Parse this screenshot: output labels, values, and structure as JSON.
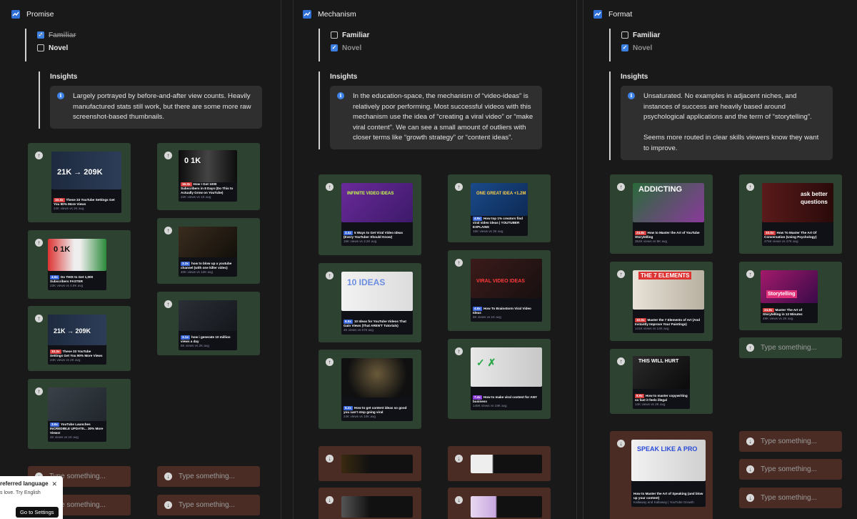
{
  "columns": [
    {
      "title": "Promise",
      "options": [
        {
          "label": "Familiar",
          "checked": true
        },
        {
          "label": "Novel",
          "checked": false
        }
      ],
      "insights_title": "Insights",
      "insights": [
        "Largely portrayed by before-and-after view counts. Heavily manufactured stats still work, but there are some more raw screenshot-based thumbnails."
      ],
      "placeholder": "Type something..."
    },
    {
      "title": "Mechanism",
      "options": [
        {
          "label": "Familiar",
          "checked": false
        },
        {
          "label": "Novel",
          "checked": true
        }
      ],
      "insights_title": "Insights",
      "insights": [
        "In the education-space, the mechanism of “video-ideas” is relatively poor performing. Most successful videos with this mechanism use the idea of “creating a viral video” or “make viral content”. We can see a small amount of outliers with closer terms like  “growth strategy” or “content ideas”."
      ],
      "placeholder": "Type something..."
    },
    {
      "title": "Format",
      "options": [
        {
          "label": "Familiar",
          "checked": false
        },
        {
          "label": "Novel",
          "checked": true
        }
      ],
      "insights_title": "Insights",
      "insights": [
        "Unsaturated. No examples in adjacent niches, and instances of success are heavily based around psychological applications and the term of “storytelling”.",
        "Seems more routed in clear skills viewers know they want to improve."
      ],
      "placeholder": "Type something..."
    }
  ],
  "thumbs": {
    "p1": {
      "big": "21K → 209K",
      "tag": "10.3x",
      "title": "These 33 YouTube Settings Get You 90% More Views",
      "meta": "24K views vs 2K avg"
    },
    "p2": {
      "big": "0  1K",
      "tag": "4.6x",
      "title": "Do THIS to Get 1,000 Subscribers FASTER",
      "meta": "23K views vs 4.9K avg"
    },
    "p3": {
      "big": "21K → 209K",
      "tag": "10.3x",
      "title": "These 33 YouTube Settings Get You 90% More Views",
      "meta": "24K views vs 2K avg"
    },
    "p4": {
      "big": "",
      "tag": "3.6x",
      "title": "YouTube Launches INCREDIBLE UPDATE... 30% More Views!",
      "meta": "4K views vs 1K avg"
    },
    "p5": {
      "big": "0  1K",
      "tag": "16.3x",
      "title": "How I Got 1000 Subscribers in 8 Days (Do This to Actually Grow on YouTube)",
      "meta": "22K views vs 1K avg"
    },
    "p6": {
      "big": "",
      "tag": "3.3x",
      "title": "how to blow up a youtube channel (with one killer video)",
      "meta": "40K views vs 12K avg"
    },
    "p7": {
      "big": "",
      "tag": "3.1x",
      "title": "how i generate 10 million views a day",
      "meta": "6K views vs 2K avg"
    },
    "m1": {
      "big": "INFINITE VIDEO IDEAS",
      "tag": "3.4x",
      "title": "5 Ways to Get Viral Video Ideas (Every YouTuber Should Know)",
      "meta": "15K views vs 3.2K avg"
    },
    "m2": {
      "big": "10 IDEAS",
      "tag": "6.5x",
      "title": "10 Ideas for YouTube Videos That Gain Views (That AREN'T Tutorials)",
      "meta": "4K views vs 670 avg"
    },
    "m3": {
      "big": "",
      "tag": "5.2x",
      "title": "How to get content ideas so good you can't stop going viral",
      "meta": "24K views vs 10K avg"
    },
    "m4": {
      "big": "ONE GREAT IDEA +1.2M",
      "tag": "4.9x",
      "title": "How top 1% creators find viral video ideas | YOUTUBER EXPLAINS",
      "meta": "15K views vs 3K avg"
    },
    "m5": {
      "big": "VIRAL VIDEO IDEAS",
      "tag": "4.6x",
      "title": "How To Brainstorm Viral Video Ideas",
      "meta": "6K views vs 1K avg"
    },
    "m6": {
      "big": "✓  ✗",
      "tag": "7.4x",
      "title": "How to make viral content for ANY business",
      "meta": "145K views vs 19K avg"
    },
    "f1": {
      "big": "ADDICTING",
      "tag": "24.8x",
      "title": "How to Master the Art of YouTube Storytelling",
      "meta": "354K views vs 9K avg"
    },
    "f2": {
      "big": "THE 7 ELEMENTS",
      "tag": "10.0x",
      "title": "Master the 7 Elements of Art (And Instantly Improve Your Paintings)",
      "meta": "141K views vs 14K avg"
    },
    "f3": {
      "big": "THIS WILL HURT",
      "tag": "8.9x",
      "title": "How to master copywriting so fast it feels illegal",
      "meta": "14K views vs 2K avg"
    },
    "f4": {
      "big": "SPEAK LIKE A PRO",
      "tag": "",
      "title": "How to Master the Art of Speaking (and blow up your content)",
      "meta": "Kallaway and Kallaway | YouTube Growth"
    },
    "f5": {
      "big": "ask better questions",
      "tag": "10.0x",
      "title": "How To Master The Art Of Conversation (Using Psychology)",
      "meta": "475K views vs 47K avg"
    },
    "f6": {
      "big": "Storytelling",
      "tag": "24.8x",
      "title": "Master The Art of Storytelling in 12 Minutes",
      "meta": "49K views vs 2K avg"
    }
  },
  "toast": {
    "title": "referred language",
    "sub": "s love. Try English",
    "button": "Go to Settings"
  }
}
